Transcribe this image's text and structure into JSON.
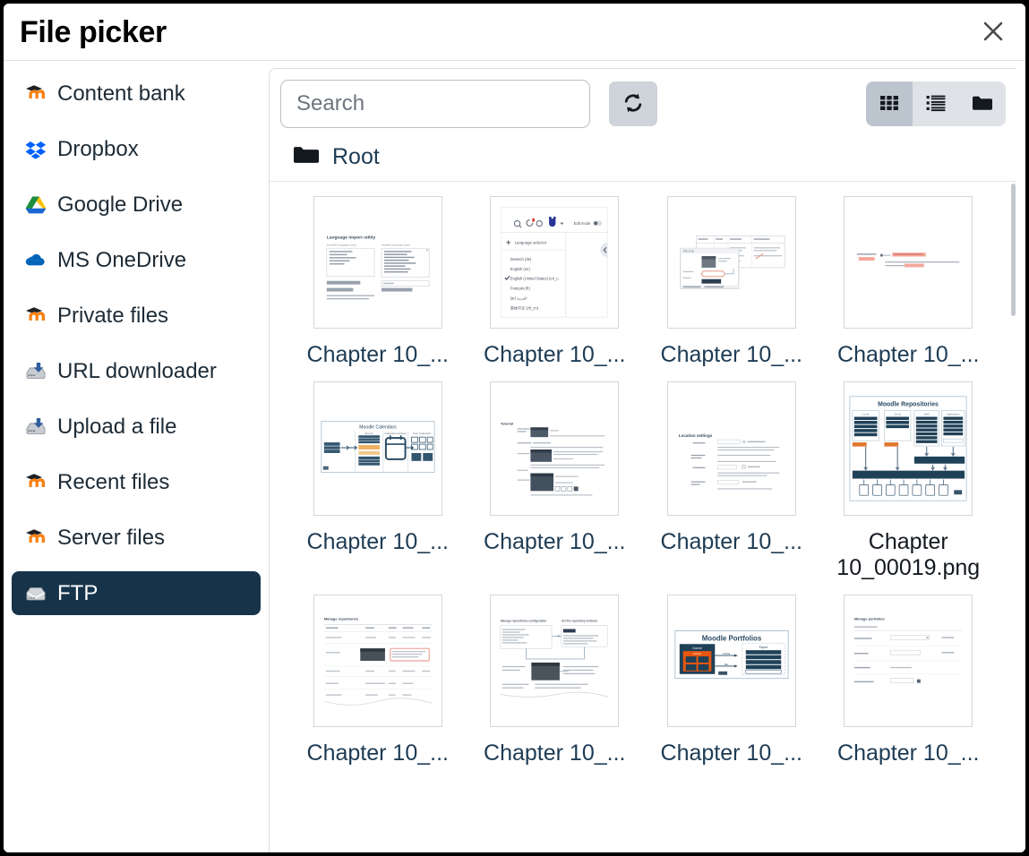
{
  "header": {
    "title": "File picker",
    "close_icon": "close-icon",
    "close_label": "Close"
  },
  "sidebar": {
    "items": [
      {
        "label": "Content bank",
        "icon": "moodle-logo-icon",
        "active": false
      },
      {
        "label": "Dropbox",
        "icon": "dropbox-logo-icon",
        "active": false
      },
      {
        "label": "Google Drive",
        "icon": "google-drive-icon",
        "active": false
      },
      {
        "label": "MS OneDrive",
        "icon": "onedrive-cloud-icon",
        "active": false
      },
      {
        "label": "Private files",
        "icon": "moodle-logo-icon",
        "active": false
      },
      {
        "label": "URL downloader",
        "icon": "server-download-icon",
        "active": false
      },
      {
        "label": "Upload a file",
        "icon": "server-download-icon",
        "active": false
      },
      {
        "label": "Recent files",
        "icon": "moodle-logo-icon",
        "active": false
      },
      {
        "label": "Server files",
        "icon": "moodle-logo-icon",
        "active": false
      },
      {
        "label": "FTP",
        "icon": "ftp-server-icon",
        "active": true
      }
    ]
  },
  "toolbar": {
    "search_placeholder": "Search",
    "search_value": "",
    "refresh_icon": "refresh-icon",
    "refresh_label": "Refresh",
    "views": [
      {
        "name": "grid",
        "icon": "grid-view-icon",
        "active": true
      },
      {
        "name": "list",
        "icon": "list-view-icon",
        "active": false
      },
      {
        "name": "tree",
        "icon": "folder-view-icon",
        "active": false
      }
    ]
  },
  "breadcrumb": {
    "icon": "folder-icon",
    "items": [
      {
        "label": "Root"
      }
    ]
  },
  "files": [
    {
      "label": "Chapter 10_...",
      "full_name": "Chapter 10_...",
      "thumb": "doc-two-panel",
      "expanded": false
    },
    {
      "label": "Chapter 10_...",
      "full_name": "Chapter 10_...",
      "thumb": "language-selector",
      "expanded": false
    },
    {
      "label": "Chapter 10_...",
      "full_name": "Chapter 10_...",
      "thumb": "overlapping-dialogs",
      "expanded": false
    },
    {
      "label": "Chapter 10_...",
      "full_name": "Chapter 10_...",
      "thumb": "highlighted-text",
      "expanded": false
    },
    {
      "label": "Chapter 10_...",
      "full_name": "Chapter 10_...",
      "thumb": "moodle-calendars",
      "expanded": false
    },
    {
      "label": "Chapter 10_...",
      "full_name": "Chapter 10_...",
      "thumb": "tutorial-steps",
      "expanded": false
    },
    {
      "label": "Chapter 10_...",
      "full_name": "Chapter 10_...",
      "thumb": "location-settings",
      "expanded": false
    },
    {
      "label": "Chapter 10_00019.png",
      "full_name": "Chapter 10_00019.png",
      "thumb": "moodle-repositories",
      "expanded": true
    },
    {
      "label": "Chapter 10_...",
      "full_name": "Chapter 10_...",
      "thumb": "manage-repositories",
      "expanded": false
    },
    {
      "label": "Chapter 10_...",
      "full_name": "Chapter 10_...",
      "thumb": "repo-config-diagram",
      "expanded": false
    },
    {
      "label": "Chapter 10_...",
      "full_name": "Chapter 10_...",
      "thumb": "moodle-portfolios",
      "expanded": false
    },
    {
      "label": "Chapter 10_...",
      "full_name": "Chapter 10_...",
      "thumb": "manage-portfolios",
      "expanded": false
    }
  ],
  "colors": {
    "accent_navy": "#16334a",
    "link_navy": "#1d3b54",
    "moodle_orange": "#f98012",
    "dropbox_blue": "#0061fe",
    "onedrive_blue": "#0364b8",
    "toolbar_gray": "#ced4da",
    "diagram_navy": "#1f4158",
    "portfolio_orange": "#e8560f",
    "highlight_red": "#f4a79a"
  }
}
